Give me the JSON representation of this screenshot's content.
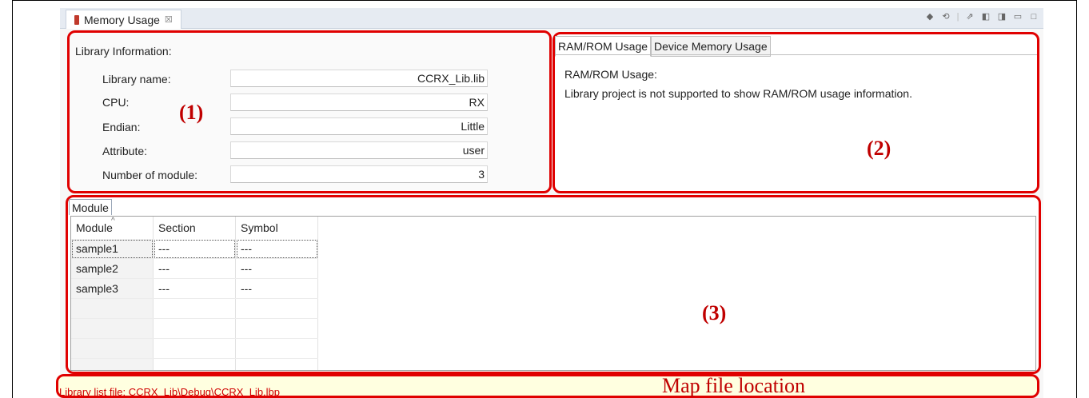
{
  "view": {
    "tab_title": "Memory Usage",
    "tab_close": "☒",
    "toolbar_icons": [
      "open-icon",
      "refresh-icon",
      "export-icon",
      "collapse-icon",
      "expand-icon",
      "minimize-icon",
      "maximize-icon"
    ]
  },
  "library": {
    "section_title": "Library Information:",
    "rows": [
      {
        "label": "Library name:",
        "value": "CCRX_Lib.lib"
      },
      {
        "label": "CPU:",
        "value": "RX"
      },
      {
        "label": "Endian:",
        "value": "Little"
      },
      {
        "label": "Attribute:",
        "value": "user"
      },
      {
        "label": "Number of module:",
        "value": "3"
      }
    ]
  },
  "markers": {
    "m1": "(1)",
    "m2": "(2)",
    "m3": "(3)",
    "map": "Map file location"
  },
  "usage": {
    "tabs": [
      "RAM/ROM Usage",
      "Device Memory Usage"
    ],
    "heading": "RAM/ROM Usage:",
    "message": "Library project is not supported to show RAM/ROM usage information."
  },
  "module": {
    "tab": "Module",
    "columns": [
      "Module",
      "Section",
      "Symbol"
    ],
    "rows": [
      [
        "sample1",
        "---",
        "---"
      ],
      [
        "sample2",
        "---",
        "---"
      ],
      [
        "sample3",
        "---",
        "---"
      ]
    ]
  },
  "status": {
    "list_file": "Library list file: CCRX_Lib\\Debug\\CCRX_Lib.lbp"
  },
  "colors": {
    "highlight": "#e00000",
    "status_text": "#d00000"
  }
}
